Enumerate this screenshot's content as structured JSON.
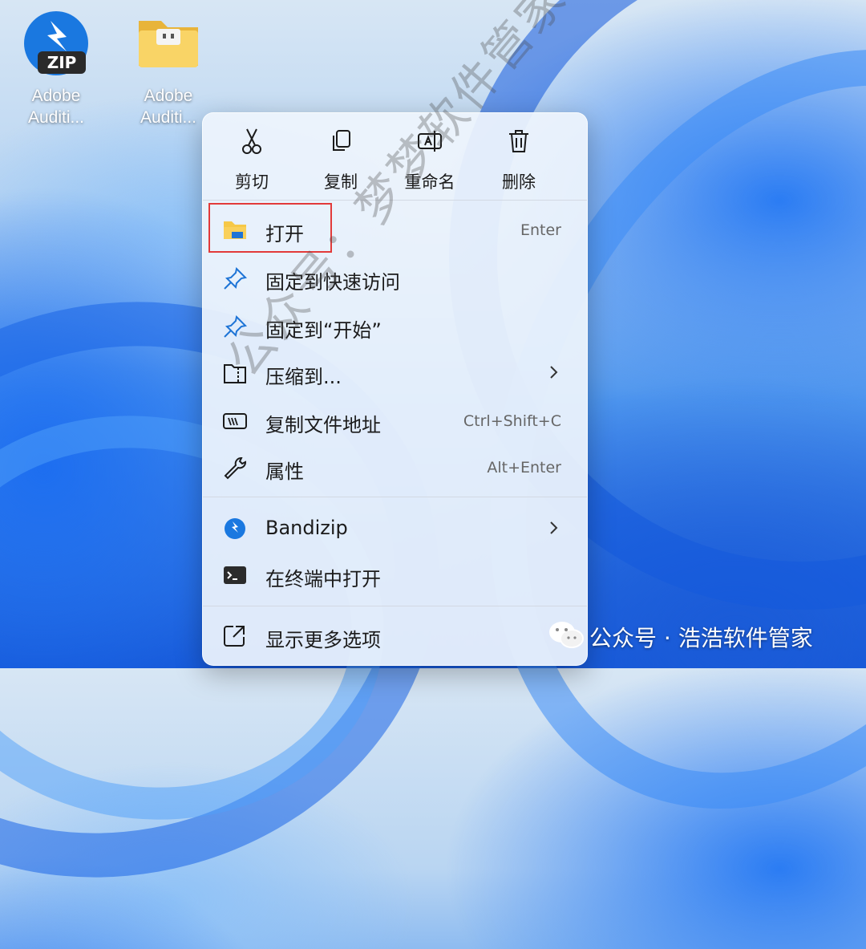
{
  "desktop": {
    "icons": [
      {
        "label_line1": "Adobe",
        "label_line2": "Auditi..."
      },
      {
        "label_line1": "Adobe",
        "label_line2": "Auditi..."
      }
    ],
    "zip_badge": "ZIP"
  },
  "context_menu": {
    "toolbar": {
      "cut": "剪切",
      "copy": "复制",
      "rename": "重命名",
      "delete": "删除"
    },
    "items": {
      "open": {
        "label": "打开",
        "shortcut": "Enter"
      },
      "pin_quick": {
        "label": "固定到快速访问"
      },
      "pin_start": {
        "label": "固定到“开始”"
      },
      "compress": {
        "label": "压缩到..."
      },
      "copy_path": {
        "label": "复制文件地址",
        "shortcut": "Ctrl+Shift+C"
      },
      "properties": {
        "label": "属性",
        "shortcut": "Alt+Enter"
      },
      "bandizip": {
        "label": "Bandizip"
      },
      "terminal": {
        "label": "在终端中打开"
      },
      "more_options": {
        "label": "显示更多选项"
      }
    }
  },
  "watermark_text": "公众号：梦梦软件管家",
  "wechat_badge": {
    "text": "公众号 · 浩浩软件管家"
  },
  "colors": {
    "accent_blue": "#0f6cd8",
    "folder_yellow": "#f6c847",
    "highlight_red": "#e23a3a"
  }
}
